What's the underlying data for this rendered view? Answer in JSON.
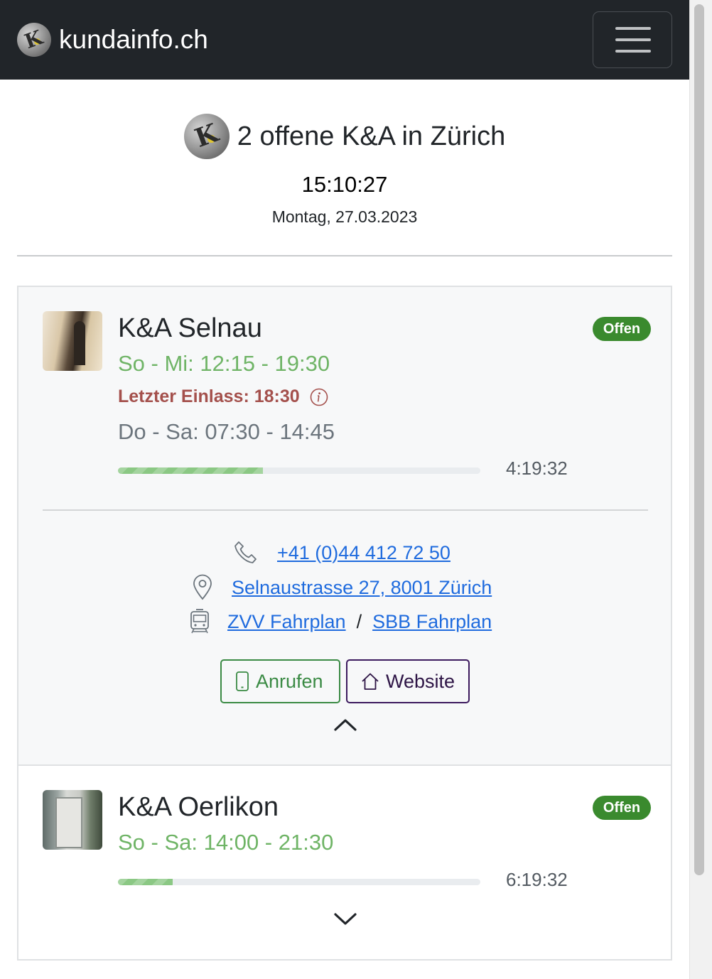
{
  "navbar": {
    "brand": "kundainfo.ch",
    "menu_icon": "hamburger-menu-icon"
  },
  "header": {
    "title": "2 offene K&A in Zürich",
    "time": "15:10:27",
    "date": "Montag, 27.03.2023"
  },
  "locations": [
    {
      "name": "K&A Selnau",
      "status": "Offen",
      "hours_open": "So - Mi: 12:15 - 19:30",
      "last_entry": "Letzter Einlass: 18:30",
      "hours_other": "Do - Sa: 07:30 - 14:45",
      "progress": 0.4,
      "remaining": "4:19:32",
      "phone": "+41 (0)44 412 72 50",
      "address": "Selnaustrasse 27, 8001 Zürich",
      "transit_separator": "/",
      "transit_zvv": "ZVV Fahrplan",
      "transit_sbb": "SBB Fahrplan",
      "call_label": "Anrufen",
      "website_label": "Website",
      "expanded": true
    },
    {
      "name": "K&A Oerlikon",
      "status": "Offen",
      "hours_open": "So - Sa: 14:00 - 21:30",
      "progress": 0.15,
      "remaining": "6:19:32",
      "expanded": false
    }
  ],
  "colors": {
    "navbar_bg": "#212529",
    "badge_green": "#3a8a2e",
    "hours_open": "#6fb466",
    "last_entry": "#a4504c",
    "link": "#1f6bde"
  }
}
